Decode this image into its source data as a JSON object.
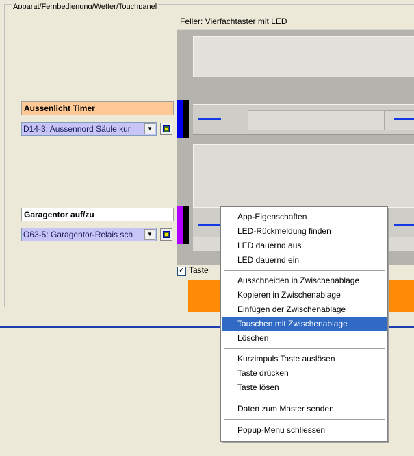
{
  "group": {
    "title": "Apparat/Fernbedienung/Wetter/Touchpanel"
  },
  "device": {
    "caption": "Feller: Vierfachtaster mit LED"
  },
  "channels": [
    {
      "label": "Aussenlicht Timer",
      "combo_value": "D14-3: Aussennord Säule kur",
      "label_bg": "#ffc996",
      "side_color": "#0000e6"
    },
    {
      "label": "Garagentor auf/zu",
      "combo_value": "O63-5: Garagentor-Relais sch",
      "label_bg": "#ffffff",
      "side_color": "#b000ff"
    }
  ],
  "checkbox": {
    "label": "Taste",
    "checked": true,
    "mark": "✓"
  },
  "colors": {
    "orange_button": "#ff8a05",
    "led_blue": "#1338e6",
    "menu_highlight": "#316ac5",
    "separator_line": "#1c3fb0"
  },
  "context_menu": {
    "items": [
      {
        "label": "App-Eigenschaften"
      },
      {
        "label": "LED-Rückmeldung finden"
      },
      {
        "label": "LED dauernd aus"
      },
      {
        "label": "LED dauernd ein"
      },
      {
        "label": "Ausschneiden in Zwischenablage"
      },
      {
        "label": "Kopieren in Zwischenablage"
      },
      {
        "label": "Einfügen der Zwischenablage"
      },
      {
        "label": "Tauschen mit Zwischenablage",
        "selected": true
      },
      {
        "label": "Löschen"
      },
      {
        "label": "Kurzimpuls Taste auslösen"
      },
      {
        "label": "Taste drücken"
      },
      {
        "label": "Taste lösen"
      },
      {
        "label": "Daten zum Master senden"
      },
      {
        "label": "Popup-Menu schliessen"
      }
    ]
  }
}
